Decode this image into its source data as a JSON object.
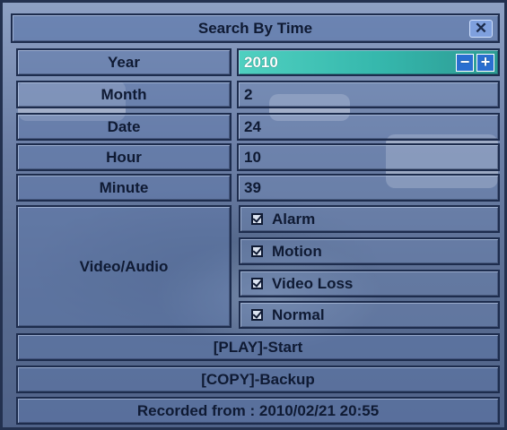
{
  "dialog": {
    "title": "Search By Time",
    "close_label": "✕",
    "fields": [
      {
        "label": "Year",
        "value": "2010"
      },
      {
        "label": "Month",
        "value": "2"
      },
      {
        "label": "Date",
        "value": "24"
      },
      {
        "label": "Hour",
        "value": "10"
      },
      {
        "label": "Minute",
        "value": "39"
      }
    ],
    "year_controls": {
      "minus": "−",
      "plus": "+"
    },
    "video_audio": {
      "label": "Video/Audio",
      "options": [
        "Alarm",
        "Motion",
        "Video Loss",
        "Normal"
      ]
    },
    "play_label": "[PLAY]-Start",
    "copy_label": "[COPY]-Backup",
    "recorded_from": "Recorded from : 2010/02/21 20:55"
  }
}
